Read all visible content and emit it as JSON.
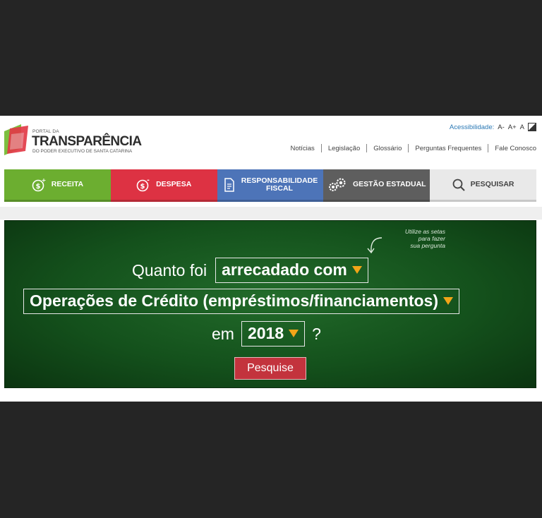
{
  "header": {
    "logo": {
      "small_text": "PORTAL DA",
      "title": "TRANSPARÊNCIA",
      "subtitle": "DO PODER EXECUTIVO DE SANTA CATARINA"
    },
    "accessibility": {
      "label": "Acessibilidade:",
      "decrease": "A-",
      "increase": "A+",
      "normal": "A"
    },
    "nav": [
      "Notícias",
      "Legislação",
      "Glossário",
      "Perguntas Frequentes",
      "Fale Conosco"
    ]
  },
  "menu": {
    "receita": "RECEITA",
    "despesa": "DESPESA",
    "responsabilidade_line1": "RESPONSABILIDADE",
    "responsabilidade_line2": "FISCAL",
    "gestao": "GESTÃO ESTADUAL",
    "pesquisar": "PESQUISAR"
  },
  "colors": {
    "receita": "#6cae30",
    "despesa": "#dd3243",
    "responsabilidade": "#4d74b8",
    "gestao": "#5e5e5e",
    "pesquisar": "#e9e9e9",
    "board": "#14511c",
    "dropdown_arrow": "#f2a518",
    "search_button": "#c3333d"
  },
  "query": {
    "hint_line1": "Utilize as setas",
    "hint_line2": "para fazer",
    "hint_line3": "sua pergunta",
    "prefix": "Quanto foi",
    "verb_selected": "arrecadado com",
    "item_selected": "Operações de Crédito (empréstimos/financiamentos)",
    "year_prefix": "em",
    "year_selected": "2018",
    "suffix": "?",
    "button": "Pesquise"
  }
}
